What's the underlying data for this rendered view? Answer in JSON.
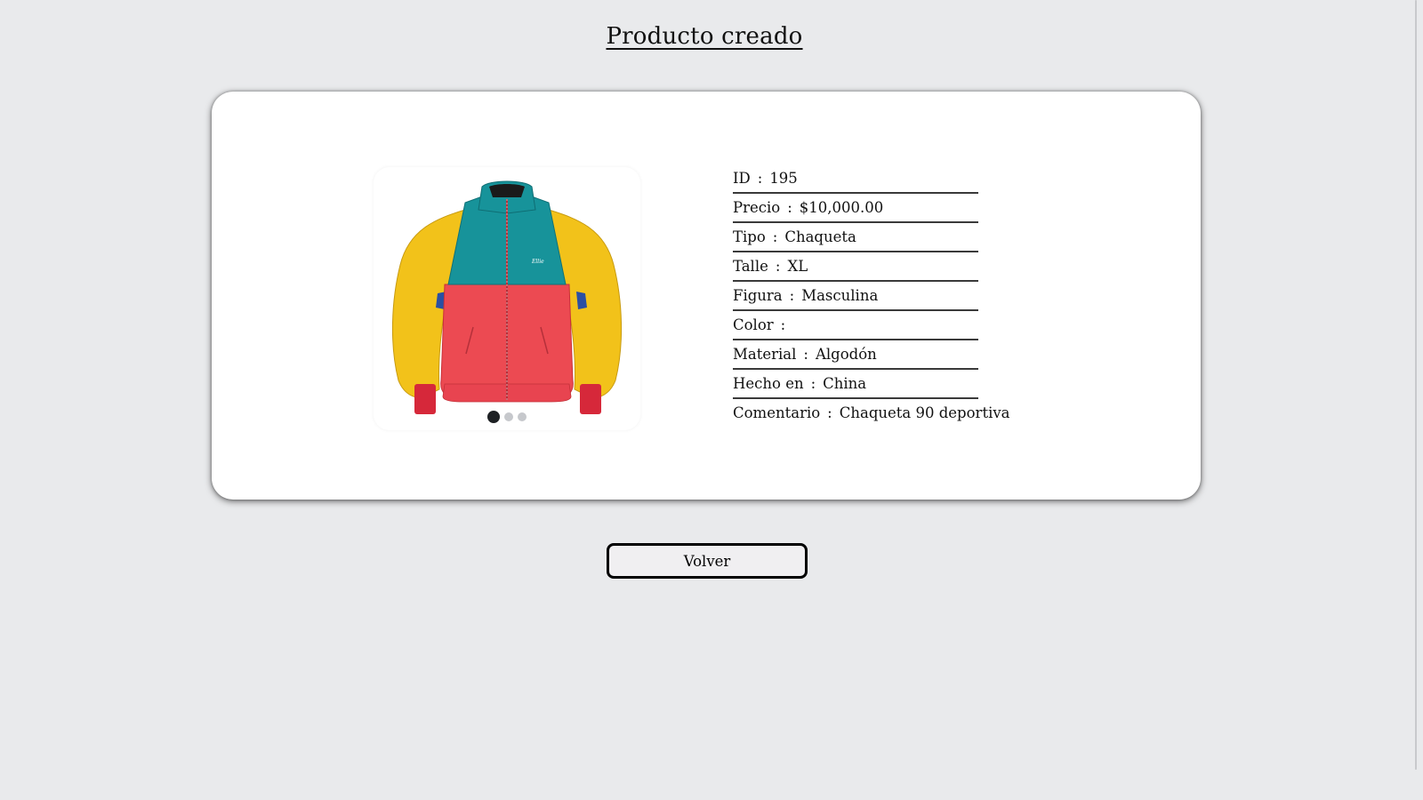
{
  "page": {
    "title": "Producto creado"
  },
  "product": {
    "image_alt_icon": "jacket-image",
    "carousel": {
      "slide_count": 3,
      "active_index": 0
    },
    "fields": [
      {
        "label": "ID",
        "value": "195"
      },
      {
        "label": "Precio",
        "value": "$10,000.00"
      },
      {
        "label": "Tipo",
        "value": "Chaqueta"
      },
      {
        "label": "Talle",
        "value": "XL"
      },
      {
        "label": "Figura",
        "value": "Masculina"
      },
      {
        "label": "Color",
        "value": ""
      },
      {
        "label": "Material",
        "value": "Algodón"
      },
      {
        "label": "Hecho en",
        "value": "China"
      },
      {
        "label": "Comentario",
        "value": "Chaqueta 90 deportiva"
      }
    ],
    "separator": ":"
  },
  "actions": {
    "back_label": "Volver"
  },
  "colors": {
    "background": "#e9eaec",
    "card": "#ffffff",
    "jacket_yellow": "#f2c21a",
    "jacket_teal": "#17939a",
    "jacket_red": "#ec4a52",
    "jacket_cuff": "#d6283a",
    "jacket_blue": "#2b4fa3"
  }
}
